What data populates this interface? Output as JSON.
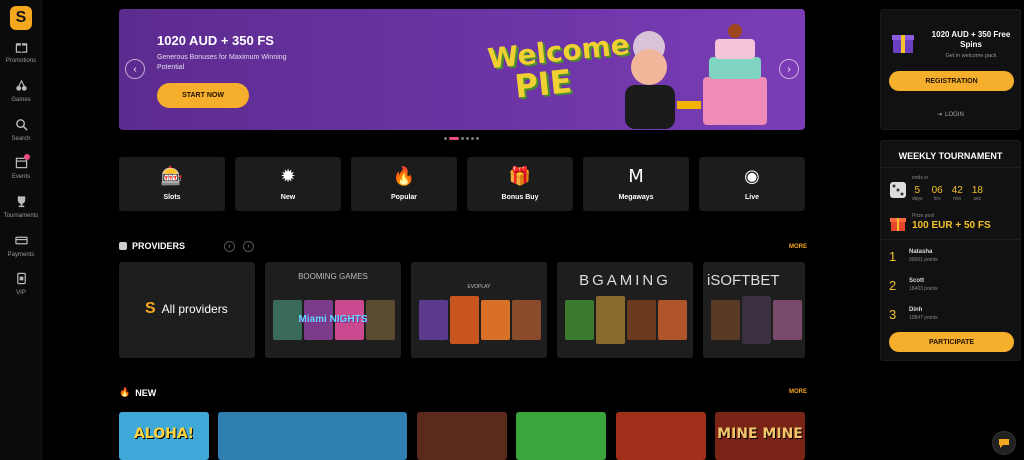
{
  "sidebar": {
    "logo": "S",
    "items": [
      {
        "label": "Promotions",
        "icon": "gift-icon"
      },
      {
        "label": "Games",
        "icon": "cherries-icon"
      },
      {
        "label": "Search",
        "icon": "search-icon"
      },
      {
        "label": "Events",
        "icon": "calendar-icon"
      },
      {
        "label": "Tournaments",
        "icon": "trophy-icon"
      },
      {
        "label": "Payments",
        "icon": "card-icon"
      },
      {
        "label": "VIP",
        "icon": "vip-icon"
      }
    ]
  },
  "banner": {
    "title": "1020 AUD + 350 FS",
    "subtitle": "Generous Bonuses for Maximum Winning Potential",
    "button": "START NOW",
    "art_word1": "Welcome",
    "art_word2": "PIE",
    "prev": "‹",
    "next": "›"
  },
  "categories": [
    {
      "label": "Slots",
      "icon": "🎰"
    },
    {
      "label": "New",
      "icon": "✹"
    },
    {
      "label": "Popular",
      "icon": "🔥"
    },
    {
      "label": "Bonus Buy",
      "icon": "🎁"
    },
    {
      "label": "Megaways",
      "icon": "M"
    },
    {
      "label": "Live",
      "icon": "◉"
    }
  ],
  "providers": {
    "title": "PROVIDERS",
    "more": "MORE",
    "all_label": "All providers",
    "all_logo": "S",
    "items": [
      {
        "name": "BOOMING GAMES",
        "game": "Miami NIGHTS"
      },
      {
        "name": "EVOPLAY",
        "game": ""
      },
      {
        "name": "BGAMING",
        "game": ""
      },
      {
        "name": "iSOFTBET",
        "game": ""
      }
    ]
  },
  "new_section": {
    "title": "NEW",
    "more": "MORE",
    "games": [
      {
        "title": "ALOHA!",
        "color": "#3ea8d8"
      },
      {
        "title": "",
        "color": "#2f7fb0"
      },
      {
        "title": "",
        "color": "#5a2a1c"
      },
      {
        "title": "",
        "color": "#3aa53c"
      },
      {
        "title": "",
        "color": "#a0301a"
      },
      {
        "title": "MINE MINE",
        "color": "#7a2418"
      }
    ]
  },
  "welcome_pack": {
    "title": "1020 AUD + 350 Free Spins",
    "sub": "Get in welcome pack",
    "register": "REGISTRATION",
    "login": "LOGIN"
  },
  "tournament": {
    "title": "WEEKLY TOURNAMENT",
    "ends_in": "ends in",
    "countdown": [
      {
        "value": "5",
        "unit": "days"
      },
      {
        "value": "06",
        "unit": "hrs"
      },
      {
        "value": "42",
        "unit": "min"
      },
      {
        "value": "18",
        "unit": "sec"
      }
    ],
    "prize_label": "Prize pool",
    "prize": "100 EUR + 50 FS",
    "winners": [
      {
        "rank": "1",
        "name": "Natasha",
        "points": "99061 points"
      },
      {
        "rank": "2",
        "name": "Scott",
        "points": "18403 points"
      },
      {
        "rank": "3",
        "name": "Dinh",
        "points": "10847 points"
      }
    ],
    "button": "PARTICIPATE"
  },
  "colors": {
    "accent": "#f6ae2d",
    "banner": "#6c34a5",
    "tile": "#1c1c1c",
    "gold": "#f4c22b"
  }
}
